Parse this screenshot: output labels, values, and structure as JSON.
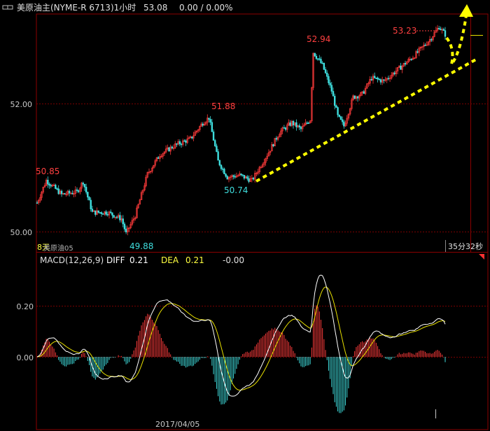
{
  "header": {
    "link_icon": "link-icon",
    "instrument": "美原油主(NYME-R 6713)1小时",
    "price": "53.08",
    "change": "0.00 / 0.00%"
  },
  "main_panel": {
    "y_ticks": [
      "52.00",
      "50.00"
    ],
    "annotations": {
      "high_left": "50.85",
      "low1": "49.88",
      "peak1": "51.88",
      "low2": "50.74",
      "peak2": "52.94",
      "last_high": "53.23"
    },
    "bottom_left_label": "8天",
    "sub_title": "美原油05",
    "countdown": "35分32秒"
  },
  "macd_panel": {
    "title": "MACD(12,26,9)",
    "diff_label": "DIFF",
    "diff_value": "0.21",
    "dea_label": "DEA",
    "dea_value": "0.21",
    "macd_value": "-0.00",
    "y_ticks": [
      "0.20",
      "0.00"
    ]
  },
  "x_axis": {
    "date_label": "2017/04/05"
  },
  "colors": {
    "up": "#ff3b3b",
    "down": "#3fdede",
    "grid": "#8b0000",
    "axis_text": "#c8c8c8",
    "diff_line": "#ffffff",
    "dea_line": "#e8e000",
    "trendline": "#ffff00"
  },
  "chart_data": [
    {
      "type": "candlestick",
      "title": "美原油主(NYME-R 6713)1小时",
      "ylim": [
        49.8,
        53.4
      ],
      "y_ticks": [
        50.0,
        52.0
      ],
      "labeled_points": {
        "high_left": 50.85,
        "low1": 49.88,
        "peak1": 51.88,
        "low2": 50.74,
        "peak2": 52.94,
        "last_high": 53.23
      },
      "last_price": 53.08,
      "close_anchors": [
        [
          0,
          50.45
        ],
        [
          6,
          50.8
        ],
        [
          16,
          50.58
        ],
        [
          26,
          50.62
        ],
        [
          30,
          50.78
        ],
        [
          36,
          50.3
        ],
        [
          46,
          50.3
        ],
        [
          55,
          50.2
        ],
        [
          58,
          49.97
        ],
        [
          64,
          50.25
        ],
        [
          72,
          50.9
        ],
        [
          80,
          51.2
        ],
        [
          90,
          51.35
        ],
        [
          100,
          51.45
        ],
        [
          108,
          51.7
        ],
        [
          112,
          51.78
        ],
        [
          118,
          51.1
        ],
        [
          124,
          50.85
        ],
        [
          132,
          50.88
        ],
        [
          140,
          50.8
        ],
        [
          150,
          51.2
        ],
        [
          158,
          51.55
        ],
        [
          166,
          51.7
        ],
        [
          172,
          51.6
        ],
        [
          178,
          51.75
        ],
        [
          180,
          52.8
        ],
        [
          186,
          52.6
        ],
        [
          192,
          52.2
        ],
        [
          196,
          51.8
        ],
        [
          200,
          51.65
        ],
        [
          206,
          52.1
        ],
        [
          212,
          52.15
        ],
        [
          218,
          52.4
        ],
        [
          226,
          52.35
        ],
        [
          236,
          52.55
        ],
        [
          246,
          52.75
        ],
        [
          256,
          53.0
        ],
        [
          262,
          53.2
        ],
        [
          266,
          53.08
        ]
      ],
      "bar_count": 267
    },
    {
      "type": "macd",
      "title": "MACD(12,26,9)",
      "series": [
        {
          "name": "DIFF",
          "value": 0.21
        },
        {
          "name": "DEA",
          "value": 0.21
        },
        {
          "name": "MACD",
          "value": -0.0
        }
      ],
      "ylim": [
        -0.22,
        0.38
      ],
      "y_ticks": [
        0.0,
        0.2
      ]
    }
  ]
}
